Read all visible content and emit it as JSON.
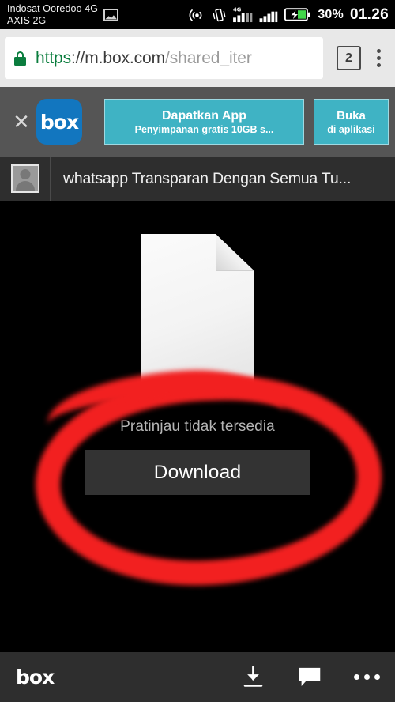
{
  "status_bar": {
    "carrier_line1": "Indosat Ooredoo 4G",
    "carrier_line2": "AXIS 2G",
    "screenshot_icon": "image-notification-icon",
    "hotspot_icon": "hotspot-icon",
    "vibrate_icon": "vibrate-icon",
    "signal1_icon": "signal-4g-icon",
    "signal1_label": "4G",
    "signal2_icon": "signal-bars-icon",
    "battery_icon": "battery-charging-icon",
    "battery_percent": "30%",
    "clock": "01.26"
  },
  "omnibox": {
    "lock_icon": "lock-icon",
    "url_scheme": "https",
    "url_host": "://m.box.com",
    "url_path": "/shared_iter",
    "tab_count": "2",
    "menu_icon": "kebab-menu-icon"
  },
  "app_banner": {
    "close_icon": "close-icon",
    "logo_text": "box",
    "primary_title": "Dapatkan App",
    "primary_subtitle": "Penyimpanan gratis 10GB s...",
    "secondary_title": "Buka",
    "secondary_subtitle": "di aplikasi",
    "accent_color": "#3fb3c4",
    "logo_color": "#1276bf"
  },
  "file_bar": {
    "avatar_icon": "avatar-placeholder-icon",
    "title": "whatsapp Transparan Dengan Semua Tu..."
  },
  "preview": {
    "doc_icon": "document-placeholder-icon",
    "no_preview_text": "Pratinjau tidak tersedia",
    "download_label": "Download",
    "annotation_icon": "red-circle-annotation",
    "annotation_color": "#f22020"
  },
  "bottom_bar": {
    "logo_text": "box",
    "download_icon": "download-icon",
    "comment_icon": "comment-icon",
    "more_icon": "more-dots-icon"
  }
}
